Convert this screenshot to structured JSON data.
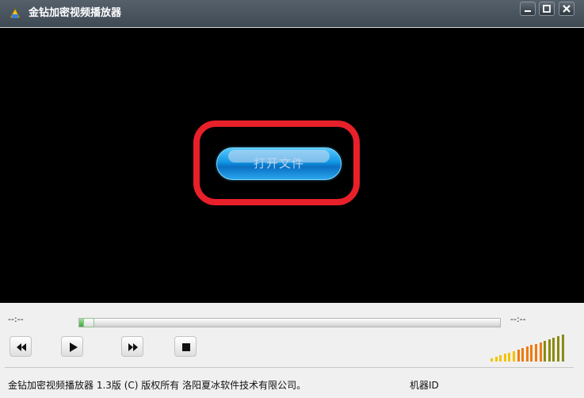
{
  "window": {
    "title": "金钻加密视频播放器"
  },
  "player": {
    "open_file_label": "打开文件"
  },
  "controls": {
    "time_elapsed": "--:--",
    "time_total": "--:--",
    "progress": 0.03,
    "volume_level": 1.0
  },
  "footer": {
    "copyright": "金钻加密视频播放器 1.3版  (C) 版权所有 洛阳夏冰软件技术有限公司。",
    "machine_id_label": "机器ID"
  },
  "colors": {
    "titlebar": "#47525d",
    "video_background": "#000000",
    "highlight_ring": "#e8202a",
    "open_button": "#1296e3",
    "progress_fill": "#3aa83a"
  },
  "icons": {
    "app": "app-icon",
    "minimize": "minimize-icon",
    "maximize": "maximize-icon",
    "close": "close-icon",
    "rewind": "rewind-icon",
    "play": "play-icon",
    "forward": "fast-forward-icon",
    "stop": "stop-icon"
  }
}
